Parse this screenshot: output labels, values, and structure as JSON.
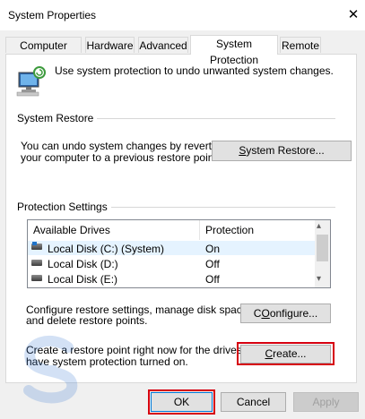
{
  "window": {
    "title": "System Properties",
    "close_glyph": "✕"
  },
  "tabs": [
    {
      "label": "Computer Name"
    },
    {
      "label": "Hardware"
    },
    {
      "label": "Advanced"
    },
    {
      "label": "System Protection"
    },
    {
      "label": "Remote"
    }
  ],
  "intro": {
    "text": "Use system protection to undo unwanted system changes."
  },
  "system_restore": {
    "group_label": "System Restore",
    "description_line1": "You can undo system changes by reverting",
    "description_line2": "your computer to a previous restore point.",
    "button_label_mnemonic": "S",
    "button_label_rest": "ystem Restore..."
  },
  "protection": {
    "group_label": "Protection Settings",
    "columns": [
      "Available Drives",
      "Protection"
    ],
    "rows": [
      {
        "drive": "Local Disk (C:) (System)",
        "protection": "On"
      },
      {
        "drive": "Local Disk (D:)",
        "protection": "Off"
      },
      {
        "drive": "Local Disk (E:)",
        "protection": "Off"
      }
    ],
    "scroll_up": "▴",
    "scroll_down": "▾"
  },
  "configure": {
    "line1": "Configure restore settings, manage disk space,",
    "line2": "and delete restore points.",
    "button_mnemonic": "O",
    "button_rest": "onfigure...",
    "button_prefix": "C"
  },
  "create": {
    "line1": "Create a restore point right now for the drives that",
    "line2": "have system protection turned on.",
    "button_mnemonic": "C",
    "button_rest": "reate..."
  },
  "footer": {
    "ok": "OK",
    "cancel": "Cancel",
    "apply": "Apply"
  },
  "colors": {
    "highlight_box": "#d6000f",
    "selected_row": "#e5f3ff"
  }
}
